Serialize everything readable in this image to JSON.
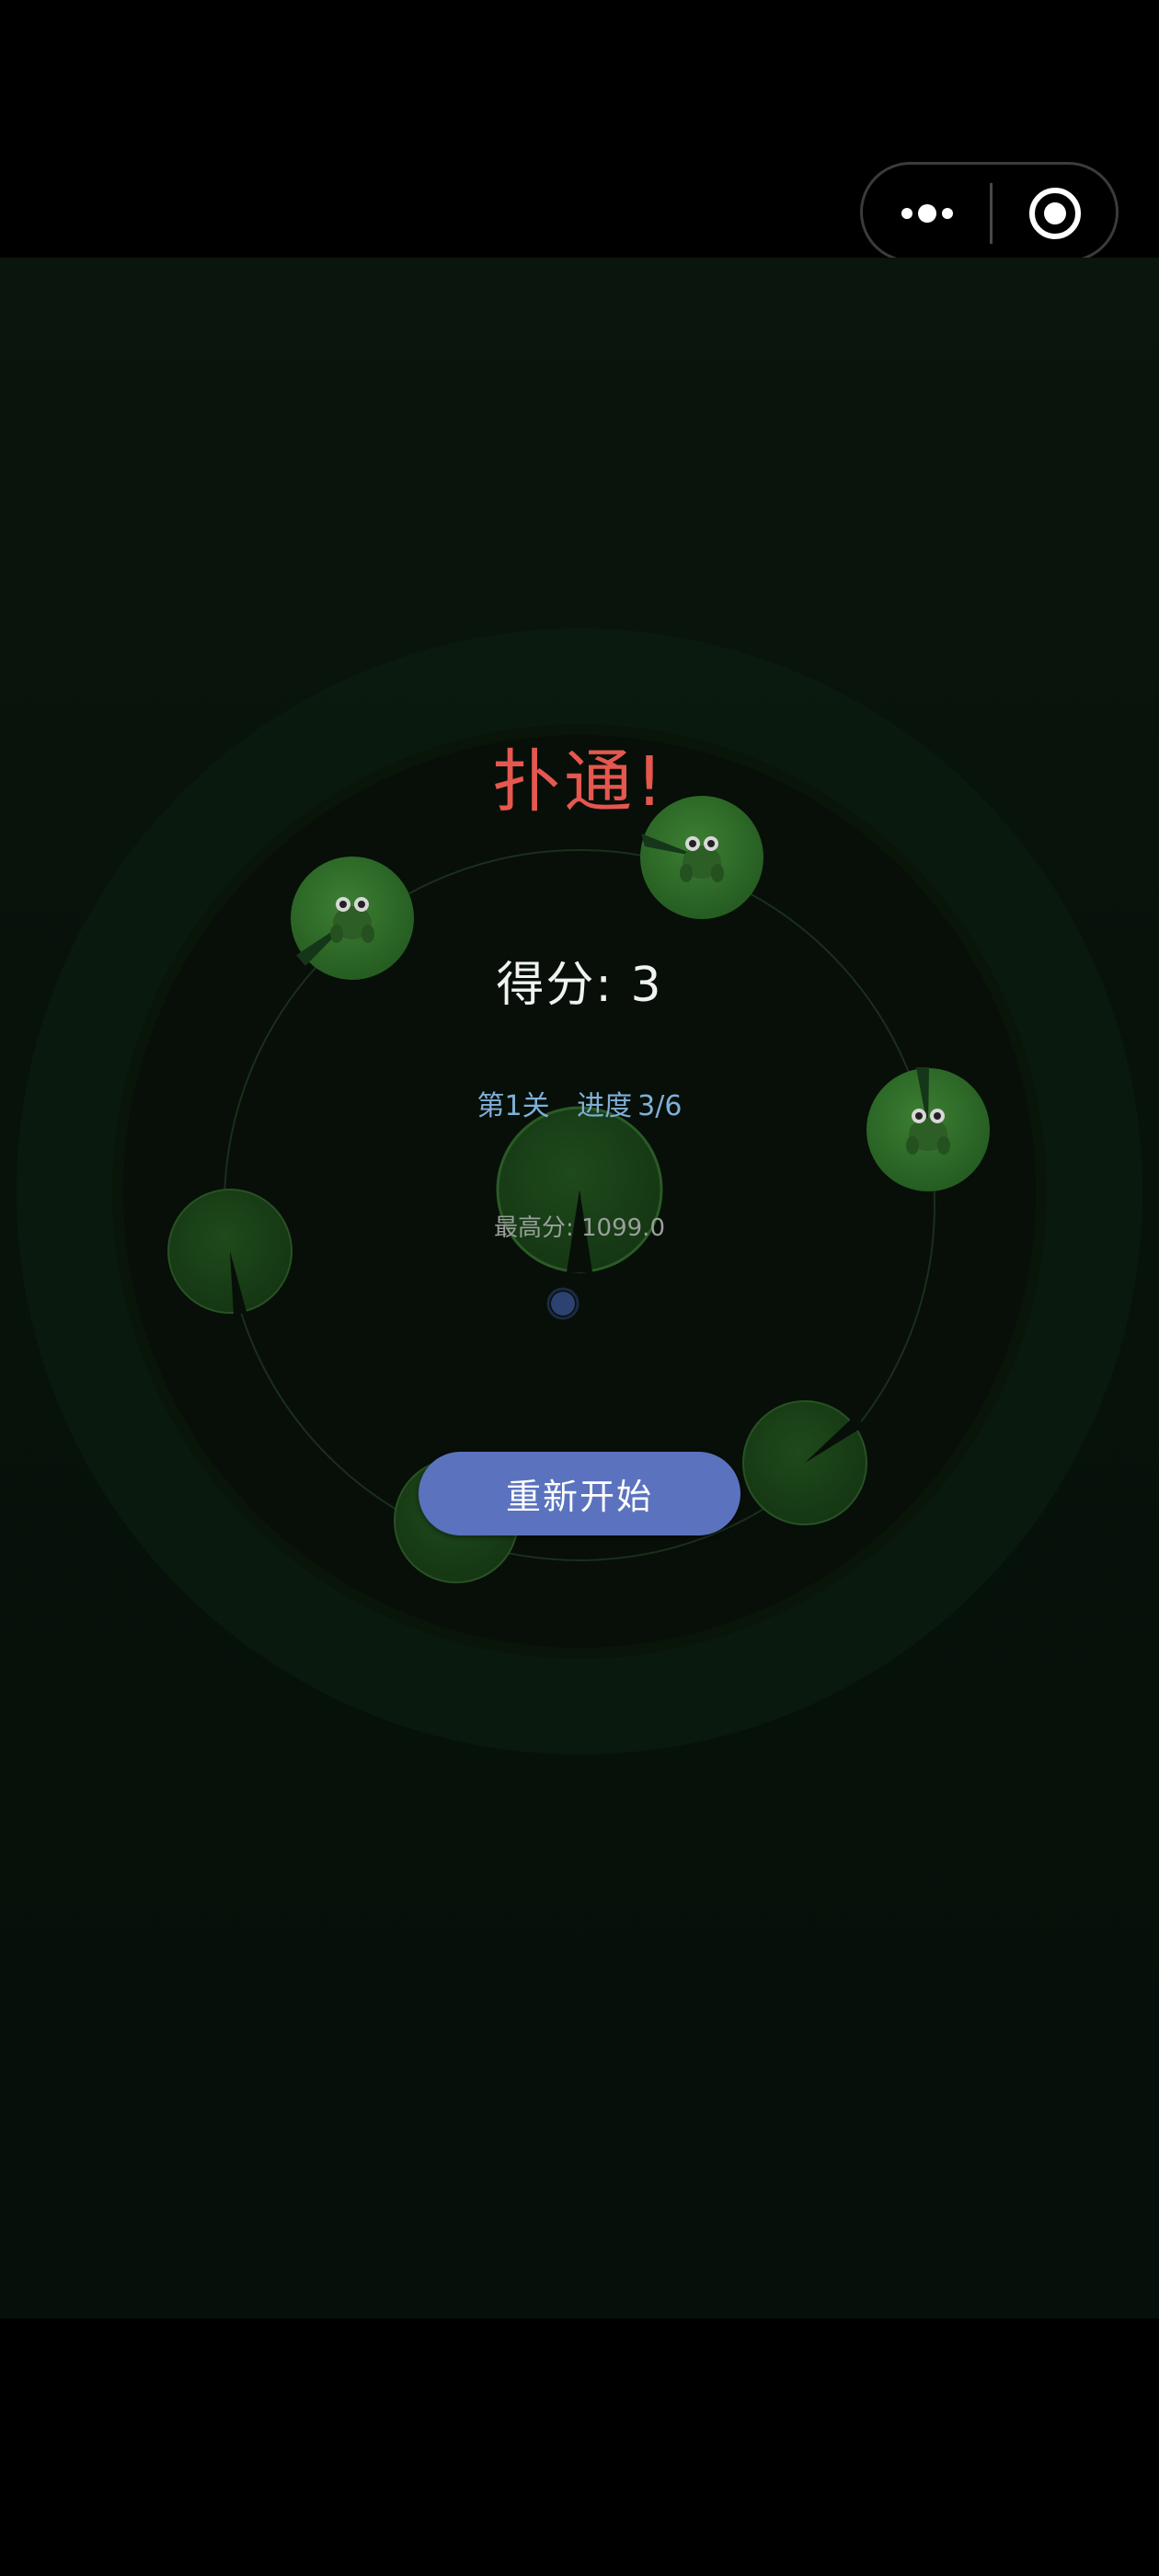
{
  "capsule": {
    "more_icon": "more-dots-icon",
    "close_icon": "target-circle-icon"
  },
  "game": {
    "result_title": "扑通!",
    "score_label": "得分:",
    "score_value": "3",
    "level_label": "第1关",
    "progress_label": "进度",
    "progress_value": "3/6",
    "best_label": "最高分:",
    "best_value": "1099.0",
    "restart_label": "重新开始",
    "lily_pads_total": 7,
    "frogs_on_pads": 3
  },
  "colors": {
    "title": "#e5574f",
    "level_text": "#7fb0d8",
    "button": "#5b73be",
    "lily_pad": "#2f6b29",
    "frog": "#2c5e25",
    "background": "#081209"
  }
}
